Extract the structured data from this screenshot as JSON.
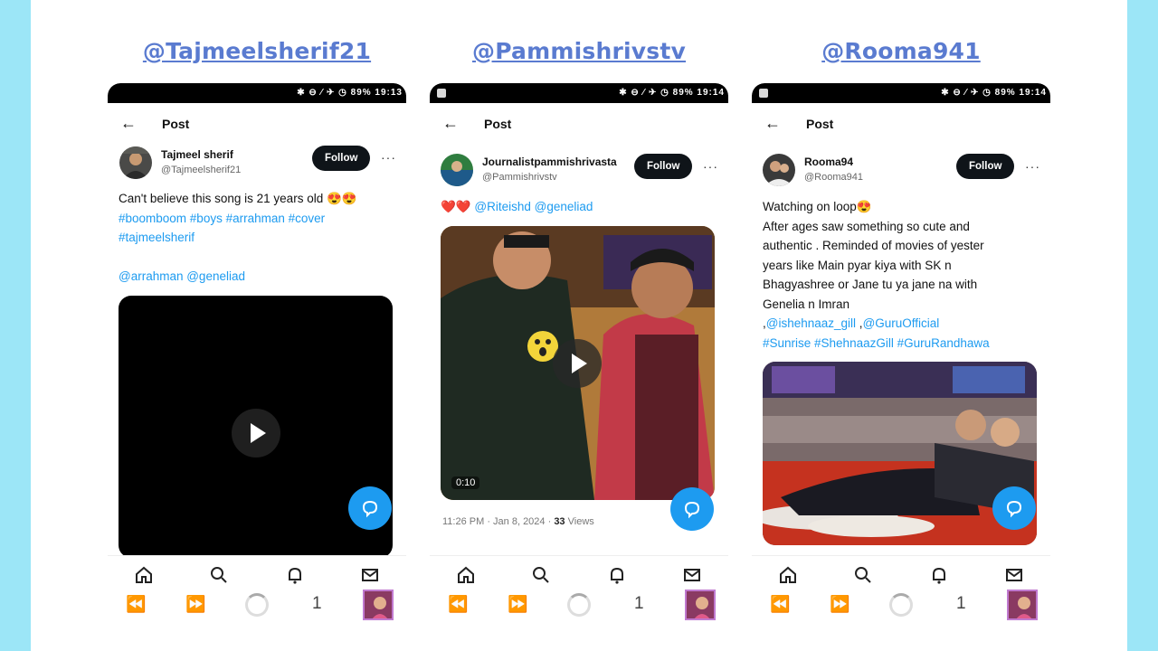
{
  "columns": [
    {
      "handle": "@Tajmeelsherif21",
      "status": "✱ ⊖ ⁄ ✈ ◷ 89% 19:13",
      "nav_title": "Post",
      "user": {
        "name": "Tajmeel sherif",
        "handle": "@Tajmeelsherif21"
      },
      "follow": "Follow",
      "text_line1": "Can't believe this song is 21 years old 😍😍",
      "tags1": "#boomboom #boys #arrahman #cover",
      "tags2": "#tajmeelsherif",
      "mentions": "@arrahman @geneliad",
      "page": "1"
    },
    {
      "handle": "@Pammishrivstv",
      "status": "✱ ⊖ ⁄ ✈ ◷ 89% 19:14",
      "nav_title": "Post",
      "user": {
        "name": "Journalistpammishrivasta",
        "handle": "@Pammishrivstv"
      },
      "follow": "Follow",
      "hearts": "❤️❤️",
      "mentions": "@Riteishd @geneliad",
      "video_time": "0:10",
      "meta_time": "11:26 PM · Jan 8, 2024 · ",
      "meta_views_num": "33",
      "meta_views_label": " Views",
      "page": "1"
    },
    {
      "handle": "@Rooma941",
      "status": "✱ ⊖ ⁄ ✈ ◷ 89% 19:14",
      "nav_title": "Post",
      "user": {
        "name": "Rooma94",
        "handle": "@Rooma941"
      },
      "follow": "Follow",
      "line1": "Watching on loop😍",
      "line2": "After ages saw  something  so cute and",
      "line3": "authentic . Reminded of movies of yester",
      "line4": "years like Main pyar kiya with SK n",
      "line5": "Bhagyashree or Jane tu ya jane na with",
      "line6": "Genelia n Imran",
      "line7_prefix": ",",
      "line7_m1": "@ishehnaaz_gill",
      "line7_sep": " ,",
      "line7_m2": "@GuruOfficial",
      "tags": "#Sunrise  #ShehnaazGill #GuruRandhawa",
      "page": "1"
    }
  ],
  "icons": {
    "back": "←",
    "more": "···",
    "rewind": "⏪",
    "forward": "⏩"
  },
  "colors": {
    "accent": "#1d9bf0",
    "handle_link": "#5a7bd0",
    "side": "#9ce6f7",
    "follow_bg": "#0f1419"
  }
}
